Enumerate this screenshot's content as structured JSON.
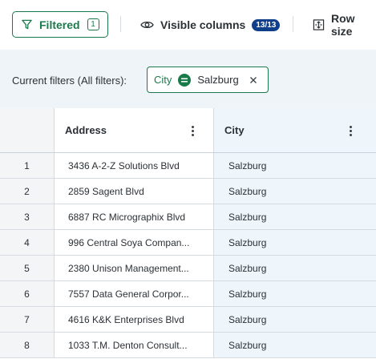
{
  "toolbar": {
    "filtered_label": "Filtered",
    "filtered_count": "1",
    "visible_columns_label": "Visible columns",
    "visible_columns_badge": "13/13",
    "row_size_label": "Row size"
  },
  "filters": {
    "label": "Current filters (All filters):",
    "chip": {
      "column": "City",
      "operator": "=",
      "value": "Salzburg"
    }
  },
  "columns": {
    "address": "Address",
    "city": "City"
  },
  "rows": [
    {
      "index": "1",
      "address": "3436 A-2-Z Solutions Blvd",
      "city": "Salzburg"
    },
    {
      "index": "2",
      "address": "2859 Sagent Blvd",
      "city": "Salzburg"
    },
    {
      "index": "3",
      "address": "6887 RC Micrographix Blvd",
      "city": "Salzburg"
    },
    {
      "index": "4",
      "address": "996 Central Soya Compan...",
      "city": "Salzburg"
    },
    {
      "index": "5",
      "address": "2380 Unison Management...",
      "city": "Salzburg"
    },
    {
      "index": "6",
      "address": "7557 Data General Corpor...",
      "city": "Salzburg"
    },
    {
      "index": "7",
      "address": "4616 K&K Enterprises Blvd",
      "city": "Salzburg"
    },
    {
      "index": "8",
      "address": "1033 T.M. Denton Consult...",
      "city": "Salzburg"
    }
  ],
  "colors": {
    "accent_green": "#1b7a4c",
    "badge_blue": "#0f3f8a",
    "filter_bar_bg": "#eef4f8",
    "city_column_bg": "#eef6fb"
  },
  "icons": [
    "funnel-icon",
    "eye-icon",
    "row-size-icon",
    "equals-icon",
    "close-icon",
    "kebab-menu-icon"
  ]
}
